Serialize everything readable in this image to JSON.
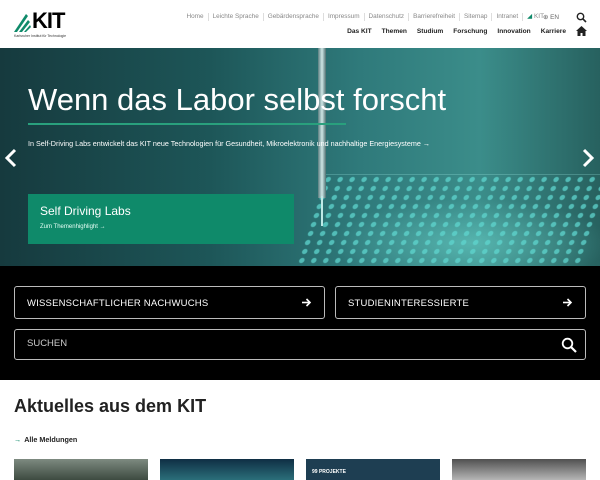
{
  "brand": {
    "name": "KIT",
    "subtitle": "Karlsruher Institut für Technologie"
  },
  "top_links": [
    "Home",
    "Leichte Sprache",
    "Gebärdensprache",
    "Impressum",
    "Datenschutz",
    "Barrierefreiheit",
    "Sitemap",
    "Intranet",
    "KIT"
  ],
  "language": "EN",
  "main_nav": [
    "Das KIT",
    "Themen",
    "Studium",
    "Forschung",
    "Innovation",
    "Karriere"
  ],
  "hero": {
    "title": "Wenn das Labor selbst forscht",
    "text": "In Self-Driving Labs entwickelt das KIT neue Technologien für Gesundheit, Mikroelektronik und nachhaltige Energiesysteme",
    "cta_title": "Self Driving Labs",
    "cta_link": "Zum Themenhighlight"
  },
  "quick_buttons": [
    "WISSENSCHAFTLICHER NACHWUCHS",
    "STUDIENINTERESSIERTE"
  ],
  "search": {
    "placeholder": "SUCHEN"
  },
  "news": {
    "heading": "Aktuelles aus dem KIT",
    "all_link": "Alle Meldungen",
    "thumb3_text": "99 PROJEKTE"
  },
  "colors": {
    "accent": "#0f8a6a",
    "black": "#000000"
  }
}
